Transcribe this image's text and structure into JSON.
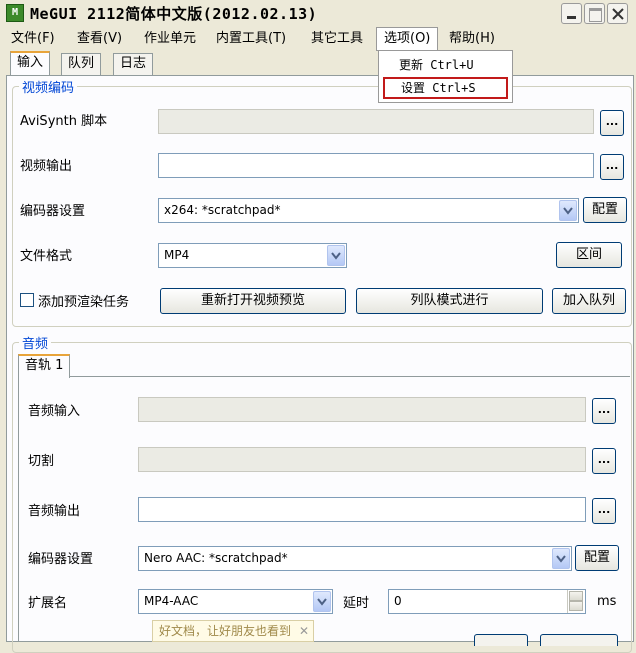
{
  "window": {
    "icon_text": "M",
    "title": "MeGUI 2112简体中文版(2012.02.13)"
  },
  "menu": {
    "items": [
      "文件(F)",
      "查看(V)",
      "作业单元",
      "内置工具(T)",
      "其它工具",
      "选项(O)",
      "帮助(H)"
    ],
    "open_index": 5,
    "dropdown": [
      {
        "label": "更新 Ctrl+U"
      },
      {
        "label": "设置 Ctrl+S",
        "highlighted": true,
        "highlight_color": "#c21a1a"
      }
    ]
  },
  "tabs": [
    "输入",
    "队列",
    "日志"
  ],
  "video": {
    "group_title": "视频编码",
    "avisynth_label": "AviSynth 脚本",
    "avisynth_value": "",
    "output_label": "视频输出",
    "output_value": "",
    "encoder_label": "编码器设置",
    "encoder_value": "x264: *scratchpad*",
    "config_button": "配置",
    "format_label": "文件格式",
    "format_value": "MP4",
    "range_button": "区间",
    "prerender_label": "添加预渲染任务",
    "prerender_checked": false,
    "reopen_preview_button": "重新打开视频预览",
    "queue_mode_button": "列队模式进行",
    "add_queue_button": "加入队列",
    "browse_button": "..."
  },
  "audio": {
    "group_title": "音频",
    "track_tab": "音轨 1",
    "input_label": "音频输入",
    "input_value": "",
    "cut_label": "切割",
    "cut_value": "",
    "output_label": "音频输出",
    "output_value": "",
    "encoder_label": "编码器设置",
    "encoder_value": "Nero AAC: *scratchpad*",
    "config_button": "配置",
    "ext_label": "扩展名",
    "ext_value": "MP4-AAC",
    "delay_label": "延时",
    "delay_value": "0",
    "delay_unit": "ms",
    "browse_button": "..."
  },
  "watermark": {
    "text": "好文档，让好朋友也看到",
    "close": "✕"
  },
  "colors": {
    "group_title": "#0046d5",
    "window_bg": "#ece9d8",
    "panel_bg": "#fcfcfe",
    "highlight_box": "#c21a1a"
  }
}
